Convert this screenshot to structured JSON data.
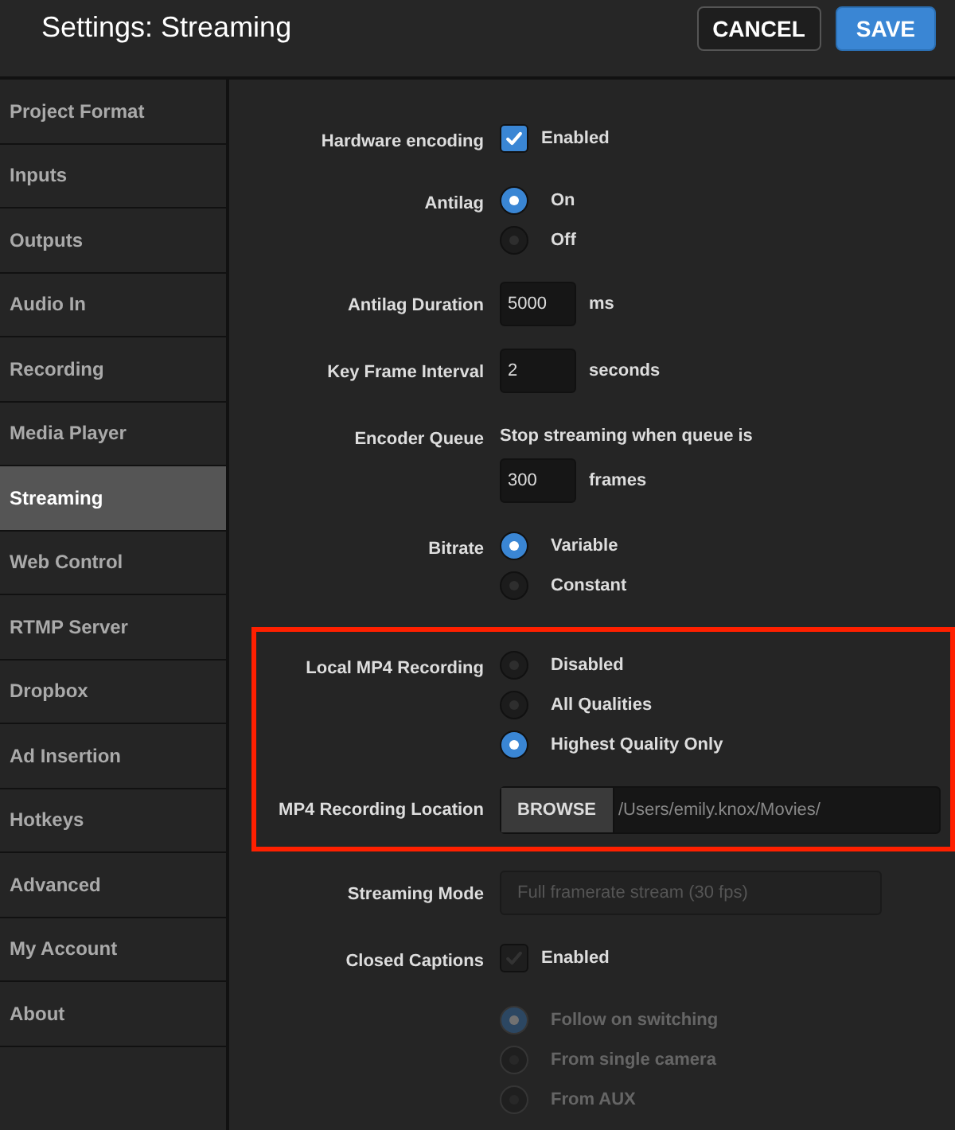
{
  "header": {
    "title": "Settings: Streaming",
    "buttons": [
      {
        "label": "CANCEL",
        "kind": "secondary"
      },
      {
        "label": "SAVE",
        "kind": "primary"
      }
    ]
  },
  "sidebar": {
    "items": [
      {
        "label": "Project Format",
        "selected": false
      },
      {
        "label": "Inputs",
        "selected": false
      },
      {
        "label": "Outputs",
        "selected": false
      },
      {
        "label": "Audio In",
        "selected": false
      },
      {
        "label": "Recording",
        "selected": false
      },
      {
        "label": "Media Player",
        "selected": false
      },
      {
        "label": "Streaming",
        "selected": true
      },
      {
        "label": "Web Control",
        "selected": false
      },
      {
        "label": "RTMP Server",
        "selected": false
      },
      {
        "label": "Dropbox",
        "selected": false
      },
      {
        "label": "Ad Insertion",
        "selected": false
      },
      {
        "label": "Hotkeys",
        "selected": false
      },
      {
        "label": "Advanced",
        "selected": false
      },
      {
        "label": "My Account",
        "selected": false
      },
      {
        "label": "About",
        "selected": false
      }
    ]
  },
  "sections": [
    {
      "highlighted": false,
      "rows": [
        {
          "kind": "checkbox",
          "label": "Hardware encoding",
          "option": "Enabled",
          "checked": true,
          "disabled": false
        },
        {
          "kind": "radio",
          "label": "Antilag",
          "disabled": false,
          "options": [
            {
              "label": "On",
              "selected": true
            },
            {
              "label": "Off",
              "selected": false
            }
          ]
        },
        {
          "kind": "number",
          "label": "Antilag Duration",
          "value": "5000",
          "unit": "ms"
        },
        {
          "kind": "number",
          "label": "Key Frame Interval",
          "value": "2",
          "unit": "seconds"
        },
        {
          "kind": "queue",
          "label": "Encoder Queue",
          "note": "Stop streaming when queue is",
          "value": "300",
          "unit": "frames"
        },
        {
          "kind": "radio",
          "label": "Bitrate",
          "disabled": false,
          "options": [
            {
              "label": "Variable",
              "selected": true
            },
            {
              "label": "Constant",
              "selected": false
            }
          ]
        }
      ]
    },
    {
      "highlighted": true,
      "rows": [
        {
          "kind": "radio",
          "label": "Local MP4 Recording",
          "disabled": false,
          "options": [
            {
              "label": "Disabled",
              "selected": false
            },
            {
              "label": "All Qualities",
              "selected": false
            },
            {
              "label": "Highest Quality Only",
              "selected": true
            }
          ]
        },
        {
          "kind": "browse",
          "label": "MP4 Recording Location",
          "button": "BROWSE",
          "path": "/Users/emily.knox/Movies/"
        }
      ]
    },
    {
      "highlighted": false,
      "rows": [
        {
          "kind": "select",
          "label": "Streaming Mode",
          "value": "Full framerate stream (30 fps)",
          "disabled": true
        },
        {
          "kind": "checkbox",
          "label": "Closed Captions",
          "option": "Enabled",
          "checked": false,
          "disabled": false
        },
        {
          "kind": "radio",
          "disabled": true,
          "options": [
            {
              "label": "Follow on switching",
              "selected": true
            },
            {
              "label": "From single camera",
              "selected": false
            },
            {
              "label": "From AUX",
              "selected": false
            }
          ]
        }
      ]
    }
  ]
}
